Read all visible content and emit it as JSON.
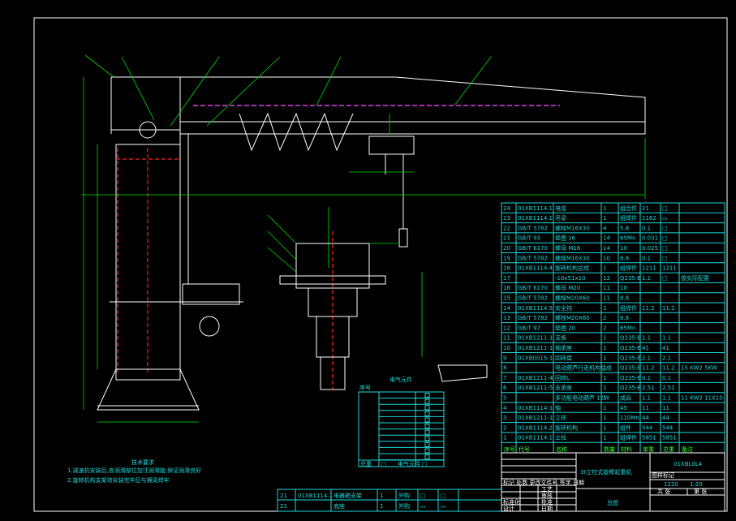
{
  "drawing": {
    "title": "3t立柱式旋臂起重机",
    "sheet_name": "总图",
    "drawing_number": "01XBL0L4",
    "scale": "1:20",
    "weight": "1210",
    "title_block_labels": {
      "stage_mark": "图样标记",
      "weight": "重量",
      "scale": "比例",
      "sheet": "共 张",
      "sheet_of": "第 张",
      "designer": "设计",
      "checker": "审核",
      "standard": "标准化",
      "process": "工艺",
      "approve": "批准",
      "date": "日期",
      "revision_header": "标记 处数 更改文件号 签字 日期"
    }
  },
  "technical_requirements": {
    "heading": "技术要求",
    "lines": [
      "1.减速机安装后,各润滑部位加注润滑脂,保证润滑良好",
      "2.旋转机构支架待安装完毕后与横梁焊牢"
    ]
  },
  "parts_table": {
    "header": [
      "序号",
      "代号",
      "名称",
      "数量",
      "材料",
      "单重",
      "总重",
      "备注"
    ],
    "rows": [
      [
        "24",
        "01XB1114.1",
        "电缆",
        "1",
        "组合件",
        "21",
        "□",
        ""
      ],
      [
        "23",
        "01XB1114.1",
        "吊梁",
        "1",
        "组焊件",
        "1162",
        "▭",
        ""
      ],
      [
        "22",
        "GB/T 5782",
        "螺栓M16X30",
        "4",
        "5.8",
        "0.1",
        "□",
        ""
      ],
      [
        "21",
        "GB/T 93",
        "垫圈 16",
        "14",
        "65Mn",
        "0.031",
        "□",
        ""
      ],
      [
        "20",
        "GB/T 6170",
        "螺母 M16",
        "14",
        "10",
        "0.025",
        "□",
        ""
      ],
      [
        "19",
        "GB/T 5782",
        "螺栓M16X30",
        "10",
        "8.8",
        "0.1",
        "□",
        ""
      ],
      [
        "18",
        "01XB1114.4",
        "旋转机构总成",
        "1",
        "组焊件",
        "1211",
        "1211",
        ""
      ],
      [
        "17",
        "",
        "-10x51x10",
        "12",
        "Q235-B",
        "1.1",
        "□",
        "按实际配置"
      ],
      [
        "16",
        "GB/T 6170",
        "螺母 M20",
        "11",
        "10",
        "",
        "",
        ""
      ],
      [
        "15",
        "GB/T 5782",
        "螺栓M20X60",
        "11",
        "8.8",
        "",
        "",
        ""
      ],
      [
        "14",
        "01XB1114.5",
        "安全钩",
        "1",
        "组焊件",
        "11.2",
        "11.2",
        ""
      ],
      [
        "13",
        "GB/T 5782",
        "螺栓M20X60",
        "2",
        "8.8",
        "",
        "",
        ""
      ],
      [
        "12",
        "GB/T 97",
        "垫圈 20",
        "2",
        "65Mn",
        "",
        "",
        ""
      ],
      [
        "11",
        "01XB1211-1",
        "支板",
        "1",
        "Q235-B",
        "1.1",
        "1.1",
        ""
      ],
      [
        "10",
        "01XB1211-1",
        "轴承座",
        "1",
        "Q235-B",
        "41",
        "41",
        ""
      ],
      [
        "9",
        "01XB0015-1",
        "回转盘",
        "1",
        "Q235-B",
        "2.1",
        "2.1",
        ""
      ],
      [
        "8",
        "",
        "电动葫芦行走机构总成",
        "1",
        "Q235-B",
        "11.2",
        "11.2",
        "15 KW2 5KW"
      ],
      [
        "7",
        "01XB1211-4",
        "回转L",
        "1",
        "Q235-B",
        "0.1",
        "0.1",
        ""
      ],
      [
        "6",
        "01XB1211-5",
        "支承座",
        "1",
        "Q235-B",
        "2.51",
        "2.51",
        ""
      ],
      [
        "5",
        "",
        "多功能电动葫芦 12W",
        "1",
        "成品",
        "1.1",
        "1.1",
        "11 KW2 11X10"
      ],
      [
        "4",
        "01XB1114-1",
        "轴",
        "1",
        "45",
        "11",
        "11",
        ""
      ],
      [
        "3",
        "01XB1211-1",
        "立柱",
        "1",
        "110Mn",
        "44",
        "44",
        ""
      ],
      [
        "2",
        "01XB1114.2",
        "旋转机构",
        "1",
        "组件",
        "544",
        "544",
        ""
      ],
      [
        "1",
        "01XB1114.1",
        "立柱",
        "1",
        "组焊件",
        "5851",
        "5851",
        ""
      ]
    ]
  },
  "bottom_table": {
    "rows": [
      [
        "21",
        "01XB1114.1",
        "电器箱支架",
        "1",
        "外购",
        "□",
        "□"
      ],
      [
        "21",
        "",
        "底座",
        "1",
        "外购",
        "▭",
        "▭"
      ]
    ]
  },
  "electrical_table": {
    "title": "电气元件",
    "label": "序号",
    "footer": [
      "总重",
      "□",
      "电气元件",
      "□"
    ]
  },
  "colors": {
    "background": "#000000",
    "outline": "#ffffff",
    "table": "#1fd8d8",
    "dimension": "#00e000",
    "centerline": "#ff2020",
    "rail": "#e040e0"
  }
}
